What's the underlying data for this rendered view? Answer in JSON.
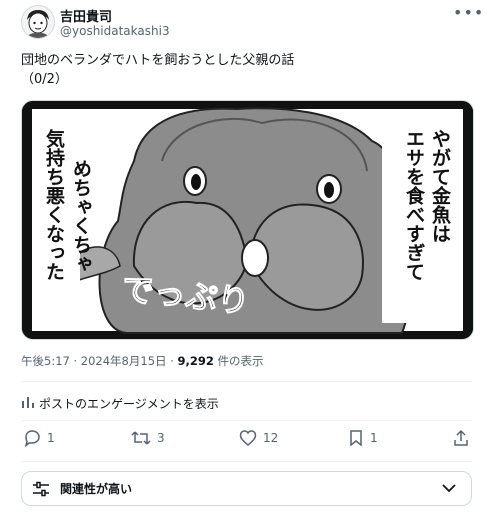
{
  "author": {
    "name": "吉田貴司",
    "handle": "@yoshidatakashi3"
  },
  "post": {
    "text": "団地のベランダでハトを飼おうとした父親の話\n（0/2）"
  },
  "comic": {
    "lines": [
      "やがて金魚は",
      "エサを食べすぎて",
      "めちゃくちゃ",
      "気持ち悪くなった"
    ],
    "sfx": "でっぷり"
  },
  "meta": {
    "time": "午後5:17 · 2024年8月15日 · ",
    "views": "9,292",
    "views_suffix": " 件の表示"
  },
  "engagement": {
    "label": "ポストのエンゲージメントを表示"
  },
  "actions": {
    "replies": "1",
    "reposts": "3",
    "likes": "12",
    "bookmarks": "1"
  },
  "sort": {
    "label": "関連性が高い"
  }
}
